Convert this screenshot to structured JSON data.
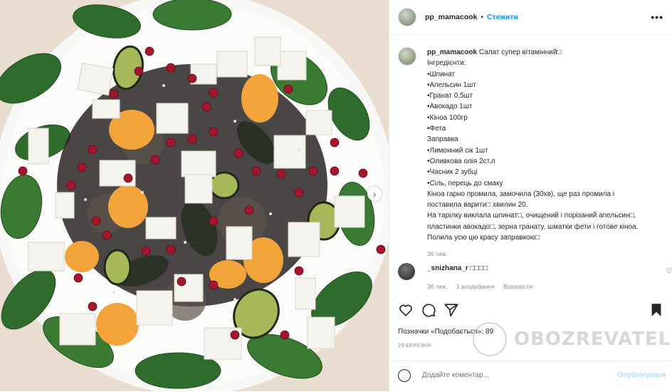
{
  "post": {
    "username": "pp_mamacook",
    "follow_label": "Стежити",
    "more_icon": "more-dots-icon",
    "caption_lines": [
      "Салат супер вітамінний□",
      "Інгредієнти:",
      "•Шпинат",
      "•Апельсин 1шт",
      "•Гранат 0,5шт",
      "•Авокадо 1шт",
      "•Кіноа 100гр",
      "•Фета",
      "Заправка",
      "•Лимонний сік 1шт",
      "•Оливкова олія 2ст.л",
      "•Часник 2 зубці",
      "•Сіль, перець до смаку",
      "Кіноа гарно промила, замочила (30хв), ще раз промила і",
      "поставила варити□ хвилин 20.",
      "На тарілку виклала шпинат□, очищений і порізаний апельсин□,",
      "пластинки авокадо□, зерна гранату, шматки фети і готове кіноа.",
      "Полила усю цю красу заправкою□"
    ],
    "caption_age": "36 тиж.",
    "likes_text": "Позначки «Подобається»: 89",
    "date": "23 БЕРЕЗНЯ",
    "comment_placeholder": "Додайте коментар...",
    "publish_label": "Опублікувати"
  },
  "comment": {
    "username": "_snizhana_r",
    "text": "□□□□",
    "age": "36 тиж.",
    "likes": "1 вподобання",
    "reply": "Відповісти"
  },
  "watermark": {
    "text": "OBOZREVATEL"
  },
  "colors": {
    "follow": "#0095f6",
    "publish_disabled": "#b3dbff",
    "meta": "#8e8e8e"
  }
}
